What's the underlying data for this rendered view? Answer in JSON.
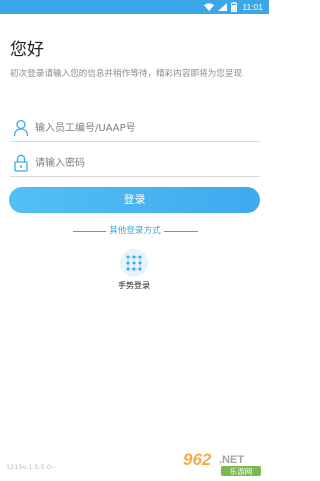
{
  "status_bar": {
    "time": "11:01",
    "background": "#3aa7ea",
    "icons": [
      "wifi-icon",
      "signal-icon",
      "battery-icon"
    ]
  },
  "header": {
    "greeting": "您好",
    "subtitle": "初次登录请输入您的信息并稍作等待，精彩内容即将为您呈现"
  },
  "form": {
    "employee_id": {
      "placeholder": "输入员工编号/UAAP号",
      "value": "",
      "icon": "user-icon"
    },
    "password": {
      "placeholder": "请输入密码",
      "value": "",
      "icon": "lock-icon"
    },
    "login_label": "登录"
  },
  "other_login": {
    "title": "其他登录方式",
    "gesture_label": "手势登录",
    "gesture_icon": "gesture-grid-icon"
  },
  "footer": {
    "version": "1215v:1.5.5.0--"
  },
  "watermark": {
    "brand": "962",
    "suffix": ".NET",
    "sub": "乐游网"
  },
  "colors": {
    "accent": "#3aa7ea",
    "button_start": "#53c0f3",
    "button_end": "#3fa9ee",
    "gesture_bg": "#e8f2fb"
  }
}
